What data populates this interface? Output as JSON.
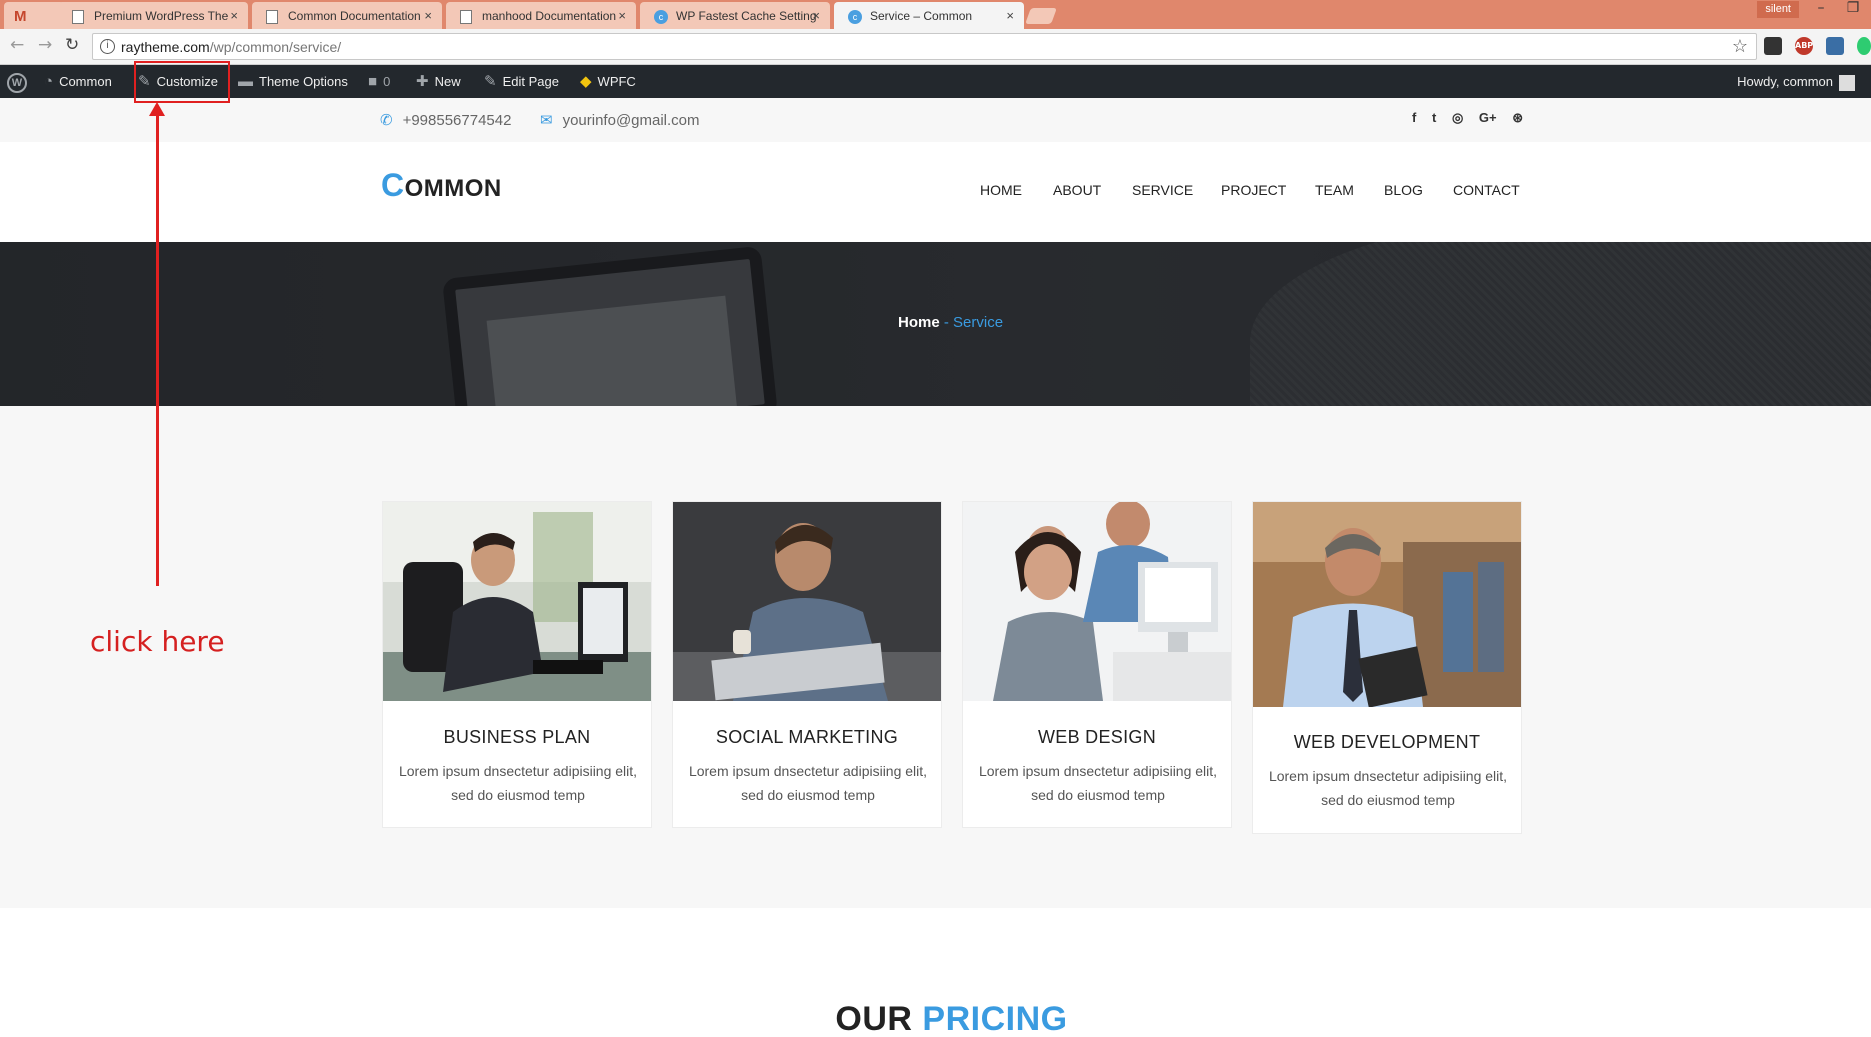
{
  "browser": {
    "tabs": [
      {
        "title": "Premium WordPress The",
        "icon": "gmail-icon"
      },
      {
        "title": "Common Documentation",
        "icon": "document-icon"
      },
      {
        "title": "manhood Documentation",
        "icon": "document-icon"
      },
      {
        "title": "WP Fastest Cache Setting",
        "icon": "site-icon"
      },
      {
        "title": "Service – Common",
        "icon": "site-icon",
        "active": true
      }
    ],
    "tab_close": "×",
    "gmail_glyph": "M",
    "profile": "silent",
    "url_host": "raytheme.com",
    "url_path": "/wp/common/service/",
    "window": {
      "minimize": "–",
      "restore": "❐"
    }
  },
  "adminbar": {
    "site": "Common",
    "customize": "Customize",
    "theme_options": "Theme Options",
    "comments_count": "0",
    "new": "New",
    "edit_page": "Edit Page",
    "wpfc": "WPFC",
    "howdy": "Howdy, common"
  },
  "contact": {
    "phone": "+998556774542",
    "email": "yourinfo@gmail.com"
  },
  "social_icons": [
    "facebook-icon",
    "twitter-icon",
    "instagram-icon",
    "google-plus-icon",
    "dribbble-icon"
  ],
  "logo": {
    "first": "C",
    "rest": "OMMON"
  },
  "menu": [
    "HOME",
    "ABOUT",
    "SERVICE",
    "PROJECT",
    "TEAM",
    "BLOG",
    "CONTACT"
  ],
  "breadcrumb": {
    "home": "Home",
    "sep": " - ",
    "current": "Service"
  },
  "services": [
    {
      "title": "BUSINESS PLAN",
      "desc": "Lorem ipsum dnsectetur adipisiing elit, sed do eiusmod temp"
    },
    {
      "title": "SOCIAL MARKETING",
      "desc": "Lorem ipsum dnsectetur adipisiing elit, sed do eiusmod temp"
    },
    {
      "title": "WEB DESIGN",
      "desc": "Lorem ipsum dnsectetur adipisiing elit, sed do eiusmod temp"
    },
    {
      "title": "WEB DEVELOPMENT",
      "desc": "Lorem ipsum dnsectetur adipisiing elit, sed do eiusmod temp"
    }
  ],
  "pricing": {
    "part1": "OUR",
    "part2": "PRICING"
  },
  "annotation": {
    "text": "click here"
  },
  "colors": {
    "accent": "#3a9be0",
    "adminbar": "#23282d",
    "annotation": "#e02020",
    "tabstrip": "#e0876c"
  }
}
